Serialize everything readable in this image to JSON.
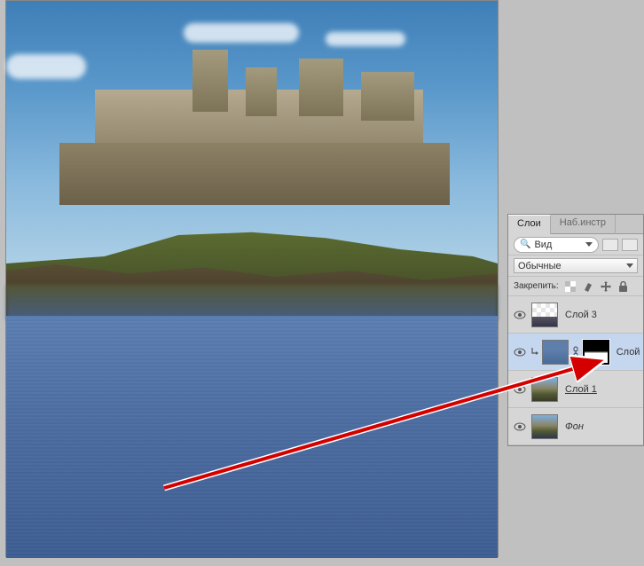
{
  "panel": {
    "tabs": {
      "layers": "Слои",
      "adjustments": "Наб.инстр"
    },
    "filter": {
      "search_placeholder": "Вид"
    },
    "blend_mode": "Обычные",
    "lock_label": "Закрепить:",
    "layers": [
      {
        "name": "Слой 3",
        "visible": true
      },
      {
        "name": "Слой",
        "visible": true,
        "selected": true,
        "has_mask": true,
        "clipped": true
      },
      {
        "name": "Слой 1",
        "visible": true,
        "smart": true
      },
      {
        "name": "Фон",
        "visible": true,
        "italic": true
      }
    ]
  },
  "icons": {
    "search": "🔍",
    "eye": "●",
    "chevron": "▾",
    "link": "⛓",
    "clip": "↳"
  }
}
